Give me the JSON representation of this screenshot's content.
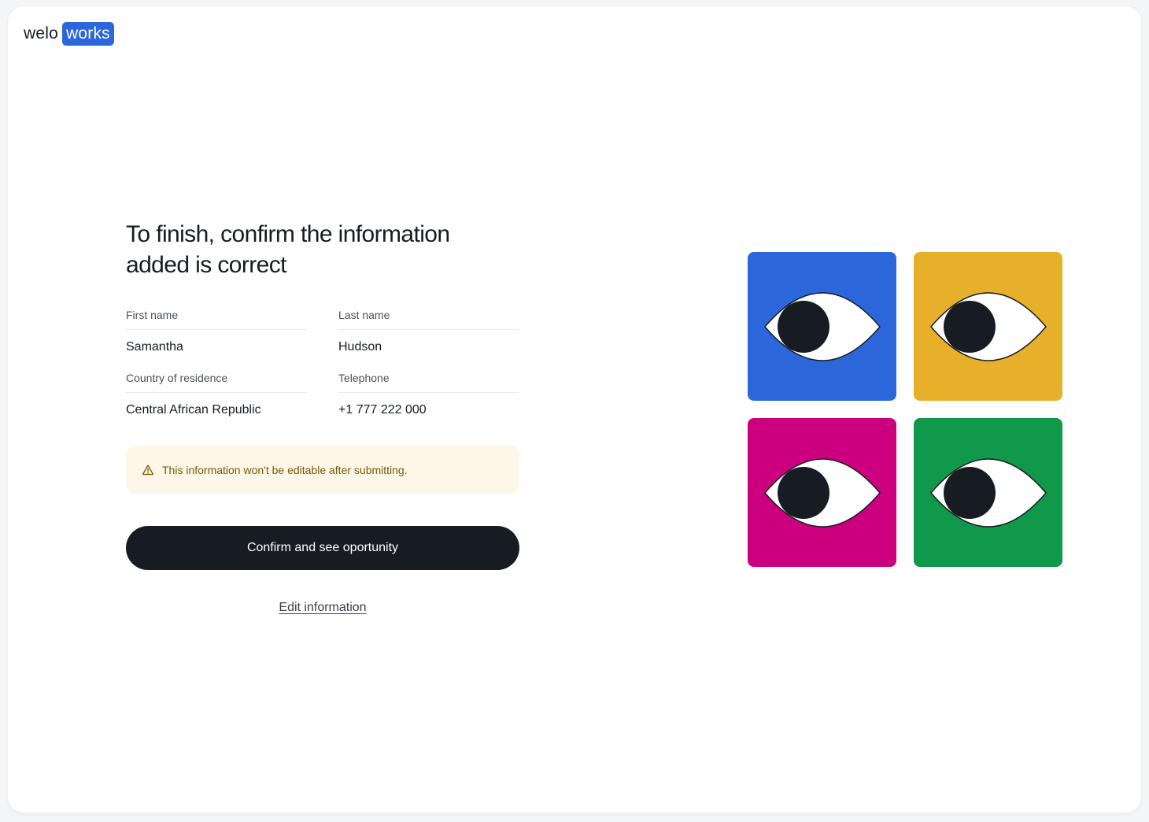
{
  "logo": {
    "part1": "welo",
    "part2": "works"
  },
  "page": {
    "title_line1": "To finish, confirm the information",
    "title_line2": "added is correct"
  },
  "fields": [
    {
      "label": "First name",
      "value": "Samantha"
    },
    {
      "label": "Last name",
      "value": "Hudson"
    },
    {
      "label": "Country of residence",
      "value": "Central African Republic"
    },
    {
      "label": "Telephone",
      "value": "+1 777 222 000"
    }
  ],
  "warning": {
    "icon": "warning-triangle-icon",
    "text": "This information won't be editable after submitting."
  },
  "actions": {
    "confirm_label": "Confirm and see oportunity",
    "edit_label": "Edit information"
  },
  "illustration": {
    "icon": "eye-icon",
    "tile_colors": [
      "#2b67db",
      "#e7b02a",
      "#cc007f",
      "#11994b"
    ]
  },
  "colors": {
    "brand": "#2b67db",
    "button": "#161c21",
    "warning_bg": "#fcf7e9",
    "warning_text": "#7a5a00"
  }
}
